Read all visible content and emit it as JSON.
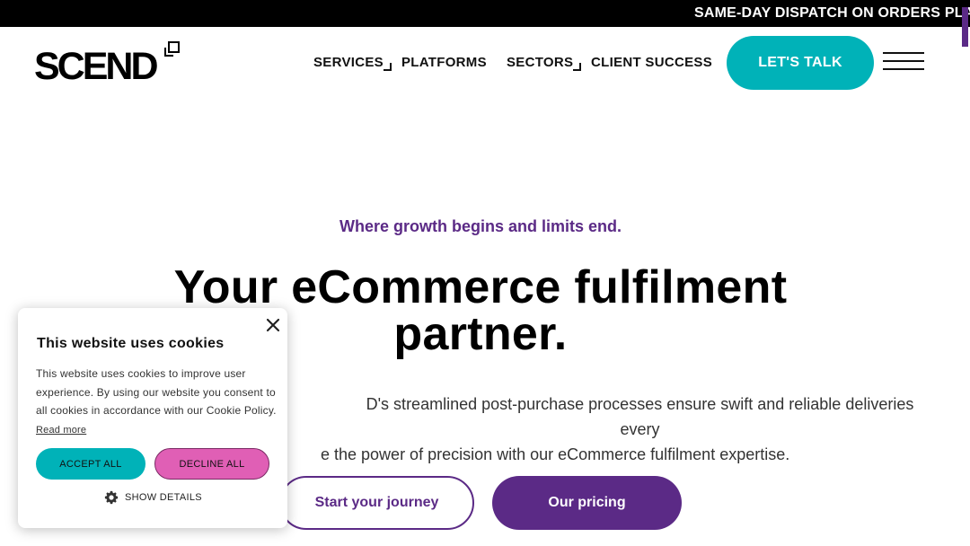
{
  "announcement": {
    "text": "SAME-DAY DISPATCH ON ORDERS PLA"
  },
  "header": {
    "logo_text": "SCEND",
    "nav": [
      {
        "label": "SERVICES"
      },
      {
        "label": "PLATFORMS"
      },
      {
        "label": "SECTORS"
      },
      {
        "label": "CLIENT SUCCESS"
      }
    ],
    "cta_label": "LET'S TALK"
  },
  "hero": {
    "kicker": "Where growth begins and limits end.",
    "title_line1": "Your eCommerce fulfilment",
    "title_line2": "partner.",
    "body_line1": "D's streamlined post-purchase processes ensure swift and reliable deliveries every",
    "body_line2": "e the power of precision with our eCommerce fulfilment expertise.",
    "primary_button": "Start your journey",
    "secondary_button": "Our pricing"
  },
  "cookie_banner": {
    "title": "This website uses cookies",
    "text": "This website uses cookies to improve user experience. By using our website you consent to all cookies in accordance with our Cookie Policy.",
    "read_more": "Read more",
    "accept_label": "ACCEPT ALL",
    "decline_label": "DECLINE ALL",
    "details_label": "SHOW DETAILS"
  },
  "colors": {
    "teal": "#00b2b8",
    "purple": "#5b2a86",
    "pink": "#e05fb5",
    "black": "#000000"
  }
}
